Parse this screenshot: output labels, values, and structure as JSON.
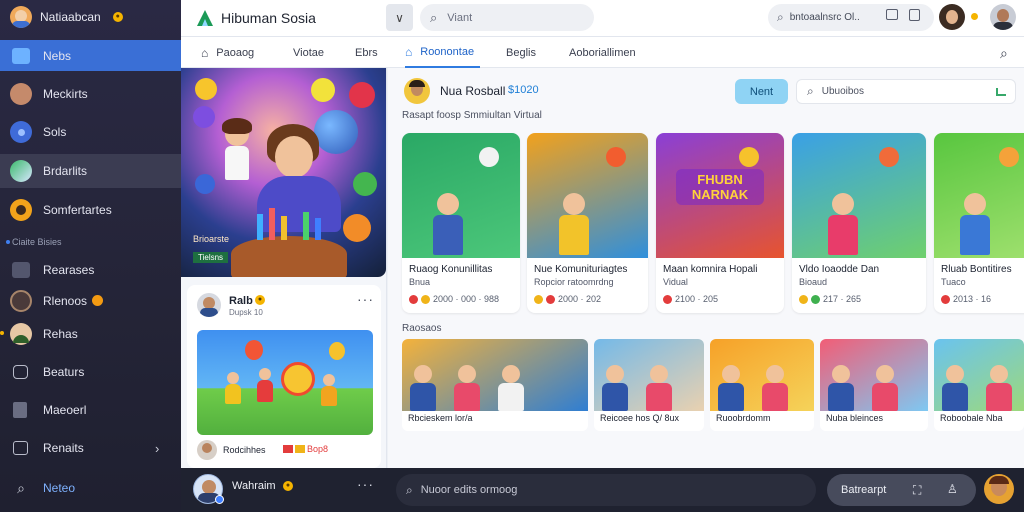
{
  "app": {
    "name": "Hibuman Sosia",
    "user_badge": "Natiaabcan"
  },
  "sidebar": {
    "items": [
      {
        "label": "Nebs"
      },
      {
        "label": "Meckirts"
      },
      {
        "label": "Sols"
      },
      {
        "label": "Brdarlits"
      },
      {
        "label": "Somfertartes"
      },
      {
        "label": "Ciaite Bisies"
      },
      {
        "label": "Rearases"
      },
      {
        "label": "Rlenoos"
      },
      {
        "label": "Rehas"
      },
      {
        "label": "Beaturs"
      },
      {
        "label": "Maeoerl"
      },
      {
        "label": "Renaits"
      },
      {
        "label": "Neteo"
      }
    ]
  },
  "topbar": {
    "search_placeholder": "Viant",
    "right_search_text": "bntoaalnsrc Ol.."
  },
  "tabs": [
    "Paoaog",
    "Viotae",
    "Ebrs",
    "Roonontae",
    "Beglis",
    "Aoboriallimen"
  ],
  "leftcol": {
    "feature_caption": "Brioarste",
    "feature_tag": "Tielsns",
    "post": {
      "name": "Ralb",
      "sub": "Dupsk 10"
    },
    "post_caption": "Rodcihhes",
    "post_meta": "Bop8"
  },
  "channel": {
    "name": "Nua Rosball",
    "count": "$1020",
    "follow_label": "Nent",
    "search_placeholder": "Ubuoibos",
    "subtitle": "Rasapt foosp Smmiultan Virtual"
  },
  "videos": [
    {
      "title": "Ruaog Konunillitas",
      "sub": "Bnua",
      "meta": "2000 · 000 · 988",
      "thumb_text": "",
      "colors": [
        "#2aa865",
        "#4cc77a"
      ]
    },
    {
      "title": "Nue Komunituriagtes",
      "sub": "Ropcior ratoomrdng",
      "meta": "2000 · 202",
      "thumb_text": "",
      "colors": [
        "#f2a11c",
        "#2f8fdc"
      ]
    },
    {
      "title": "Maan komnira Hopali",
      "sub": "Vidual",
      "meta": "2100 · 205",
      "thumb_text": "FHUBN NARNAK",
      "colors": [
        "#8a3fd6",
        "#e7542e"
      ]
    },
    {
      "title": "Vldo Ioaodde Dan",
      "sub": "Bioaud",
      "meta": "217 · 265",
      "thumb_text": "",
      "colors": [
        "#3aa0e6",
        "#6fd06d"
      ]
    },
    {
      "title": "Rluab Bontitires",
      "sub": "Tuaco",
      "meta": "2013 · 16",
      "thumb_text": "",
      "colors": [
        "#58c63f",
        "#9fe06e"
      ]
    }
  ],
  "recent_label": "Raosaos",
  "recent": [
    {
      "caption": "Rbcieskem lor/a",
      "colors": [
        "#f4b23b",
        "#2f7ed2"
      ]
    },
    {
      "caption": "Reicoee hos Q/ 8ux",
      "colors": [
        "#74b9e8",
        "#e9d1b0"
      ]
    },
    {
      "caption": "Ruoobrdomm",
      "colors": [
        "#f6a128",
        "#f5d35a"
      ]
    },
    {
      "caption": "Nuba bleinces",
      "colors": [
        "#f25d76",
        "#7ec8f2"
      ]
    },
    {
      "caption": "Roboobale Nba",
      "colors": [
        "#6ac3ef",
        "#9dd97b"
      ]
    }
  ],
  "bottombar": {
    "user": "Wahraim",
    "message_placeholder": "Nuoor edits ormoog",
    "action_label": "Batrearpt"
  }
}
